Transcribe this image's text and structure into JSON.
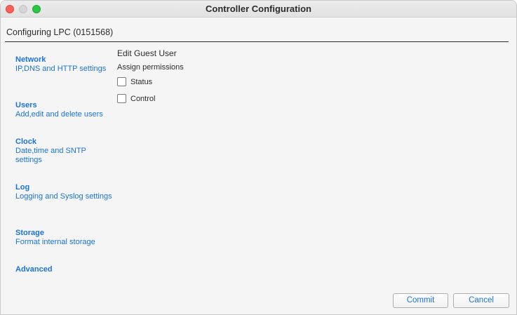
{
  "window": {
    "title": "Controller Configuration"
  },
  "header": {
    "text": "Configuring LPC (0151568)"
  },
  "sidebar": {
    "items": [
      {
        "title": "Network",
        "desc": "IP,DNS and HTTP settings"
      },
      {
        "title": "Users",
        "desc": "Add,edit and delete users"
      },
      {
        "title": "Clock",
        "desc": "Date,time and SNTP settings"
      },
      {
        "title": "Log",
        "desc": "Logging and Syslog settings"
      },
      {
        "title": "Storage",
        "desc": "Format internal storage"
      },
      {
        "title": "Advanced",
        "desc": ""
      }
    ]
  },
  "panel": {
    "title": "Edit Guest User",
    "subtitle": "Assign permissions",
    "permissions": [
      {
        "label": "Status",
        "checked": false
      },
      {
        "label": "Control",
        "checked": false
      }
    ]
  },
  "buttons": {
    "commit": "Commit",
    "cancel": "Cancel"
  },
  "colors": {
    "link": "#1a73d6",
    "close": "#fe5f57",
    "maximize": "#28c840"
  }
}
